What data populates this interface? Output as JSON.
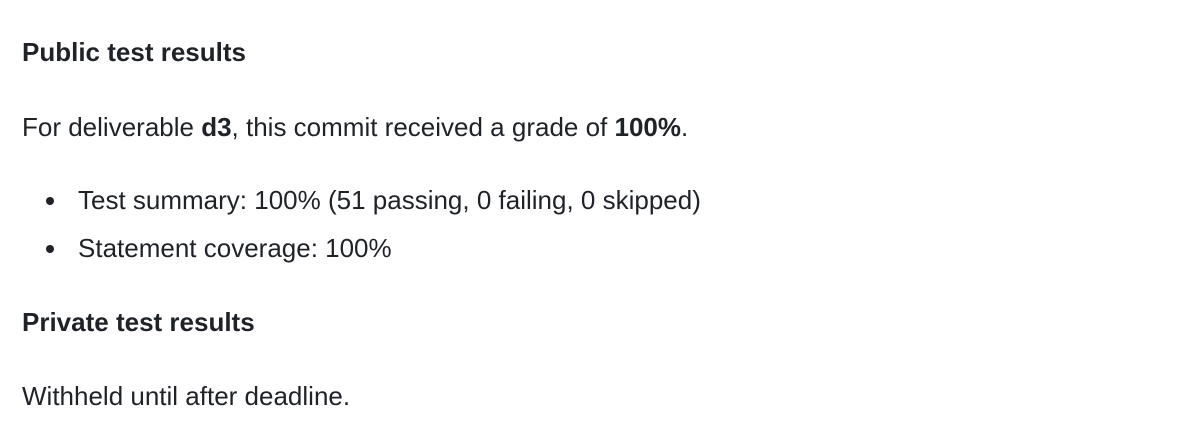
{
  "public": {
    "heading": "Public test results",
    "grade_prefix": "For deliverable ",
    "deliverable": "d3",
    "grade_middle": ", this commit received a grade of ",
    "grade": "100%",
    "grade_suffix": ".",
    "items": [
      "Test summary: 100% (51 passing, 0 failing, 0 skipped)",
      "Statement coverage: 100%"
    ]
  },
  "private": {
    "heading": "Private test results",
    "note": "Withheld until after deadline."
  }
}
